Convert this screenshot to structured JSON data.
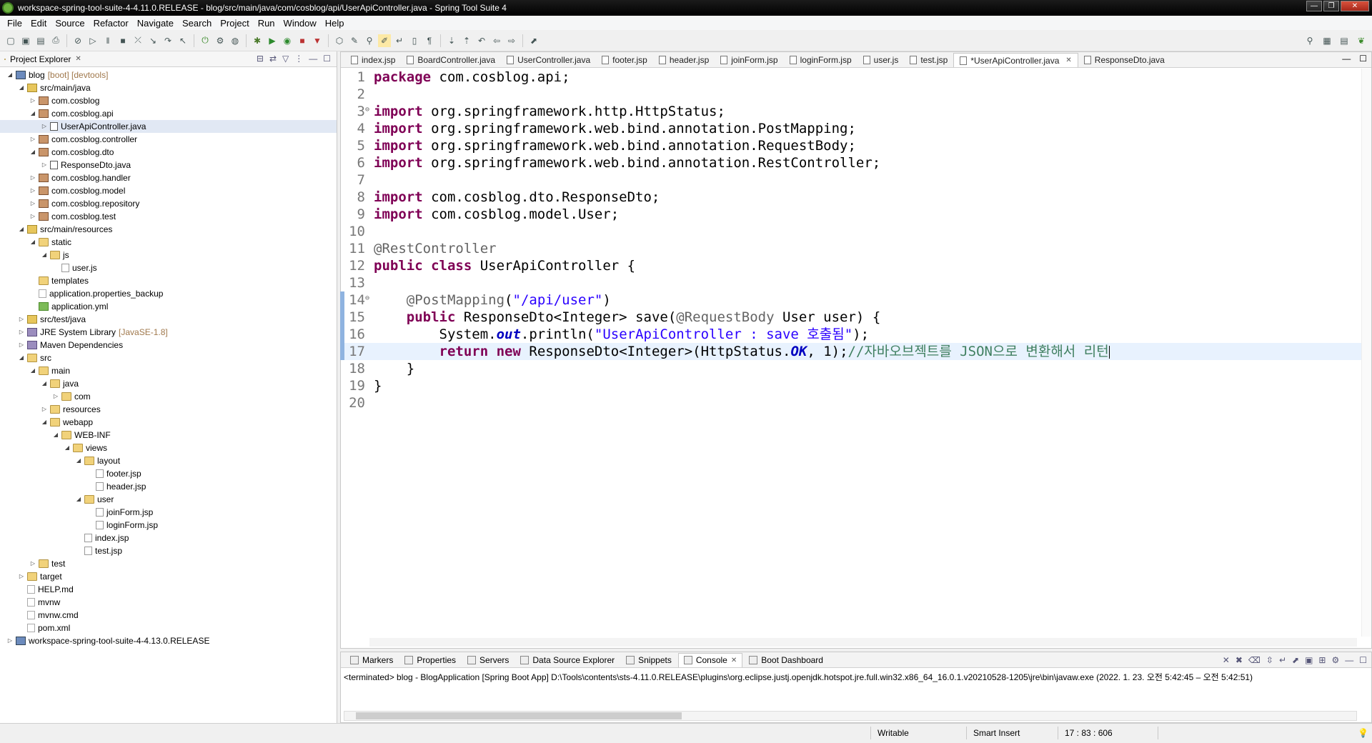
{
  "window": {
    "title": "workspace-spring-tool-suite-4-4.11.0.RELEASE - blog/src/main/java/com/cosblog/api/UserApiController.java - Spring Tool Suite 4",
    "buttons": [
      "—",
      "❐",
      "✕"
    ]
  },
  "menu": [
    "File",
    "Edit",
    "Source",
    "Refactor",
    "Navigate",
    "Search",
    "Project",
    "Run",
    "Window",
    "Help"
  ],
  "explorer": {
    "title": "Project Explorer",
    "tree": [
      {
        "label": "blog",
        "decor": "[boot] [devtools]",
        "depth": 0,
        "expanded": true,
        "icon": "project"
      },
      {
        "label": "src/main/java",
        "depth": 1,
        "expanded": true,
        "icon": "srcfolder"
      },
      {
        "label": "com.cosblog",
        "depth": 2,
        "expanded": false,
        "icon": "pkg"
      },
      {
        "label": "com.cosblog.api",
        "depth": 2,
        "expanded": true,
        "icon": "pkg"
      },
      {
        "label": "UserApiController.java",
        "depth": 3,
        "expanded": false,
        "icon": "java",
        "selected": true
      },
      {
        "label": "com.cosblog.controller",
        "depth": 2,
        "expanded": false,
        "icon": "pkg"
      },
      {
        "label": "com.cosblog.dto",
        "depth": 2,
        "expanded": true,
        "icon": "pkg"
      },
      {
        "label": "ResponseDto.java",
        "depth": 3,
        "expanded": false,
        "icon": "java"
      },
      {
        "label": "com.cosblog.handler",
        "depth": 2,
        "expanded": false,
        "icon": "pkg"
      },
      {
        "label": "com.cosblog.model",
        "depth": 2,
        "expanded": false,
        "icon": "pkg"
      },
      {
        "label": "com.cosblog.repository",
        "depth": 2,
        "expanded": false,
        "icon": "pkg"
      },
      {
        "label": "com.cosblog.test",
        "depth": 2,
        "expanded": false,
        "icon": "pkg"
      },
      {
        "label": "src/main/resources",
        "depth": 1,
        "expanded": true,
        "icon": "srcfolder"
      },
      {
        "label": "static",
        "depth": 2,
        "expanded": true,
        "icon": "folder"
      },
      {
        "label": "js",
        "depth": 3,
        "expanded": true,
        "icon": "folder"
      },
      {
        "label": "user.js",
        "depth": 4,
        "leaf": true,
        "icon": "js"
      },
      {
        "label": "templates",
        "depth": 2,
        "leaf": true,
        "icon": "folder"
      },
      {
        "label": "application.properties_backup",
        "depth": 2,
        "leaf": true,
        "icon": "file"
      },
      {
        "label": "application.yml",
        "depth": 2,
        "leaf": true,
        "icon": "yml"
      },
      {
        "label": "src/test/java",
        "depth": 1,
        "expanded": false,
        "icon": "srcfolder"
      },
      {
        "label": "JRE System Library",
        "decor": "[JavaSE-1.8]",
        "depth": 1,
        "expanded": false,
        "icon": "lib"
      },
      {
        "label": "Maven Dependencies",
        "depth": 1,
        "expanded": false,
        "icon": "lib"
      },
      {
        "label": "src",
        "depth": 1,
        "expanded": true,
        "icon": "folder"
      },
      {
        "label": "main",
        "depth": 2,
        "expanded": true,
        "icon": "folder"
      },
      {
        "label": "java",
        "depth": 3,
        "expanded": true,
        "icon": "folder"
      },
      {
        "label": "com",
        "depth": 4,
        "expanded": false,
        "icon": "folder"
      },
      {
        "label": "resources",
        "depth": 3,
        "expanded": false,
        "icon": "folder"
      },
      {
        "label": "webapp",
        "depth": 3,
        "expanded": true,
        "icon": "folder"
      },
      {
        "label": "WEB-INF",
        "depth": 4,
        "expanded": true,
        "icon": "folder"
      },
      {
        "label": "views",
        "depth": 5,
        "expanded": true,
        "icon": "folder"
      },
      {
        "label": "layout",
        "depth": 6,
        "expanded": true,
        "icon": "folder"
      },
      {
        "label": "footer.jsp",
        "depth": 7,
        "leaf": true,
        "icon": "jsp"
      },
      {
        "label": "header.jsp",
        "depth": 7,
        "leaf": true,
        "icon": "jsp"
      },
      {
        "label": "user",
        "depth": 6,
        "expanded": true,
        "icon": "folder"
      },
      {
        "label": "joinForm.jsp",
        "depth": 7,
        "leaf": true,
        "icon": "jsp"
      },
      {
        "label": "loginForm.jsp",
        "depth": 7,
        "leaf": true,
        "icon": "jsp"
      },
      {
        "label": "index.jsp",
        "depth": 6,
        "leaf": true,
        "icon": "jsp"
      },
      {
        "label": "test.jsp",
        "depth": 6,
        "leaf": true,
        "icon": "jsp"
      },
      {
        "label": "test",
        "depth": 2,
        "expanded": false,
        "icon": "folder"
      },
      {
        "label": "target",
        "depth": 1,
        "expanded": false,
        "icon": "folder"
      },
      {
        "label": "HELP.md",
        "depth": 1,
        "leaf": true,
        "icon": "file"
      },
      {
        "label": "mvnw",
        "depth": 1,
        "leaf": true,
        "icon": "file"
      },
      {
        "label": "mvnw.cmd",
        "depth": 1,
        "leaf": true,
        "icon": "file"
      },
      {
        "label": "pom.xml",
        "depth": 1,
        "leaf": true,
        "icon": "file"
      },
      {
        "label": "workspace-spring-tool-suite-4-4.13.0.RELEASE",
        "depth": 0,
        "expanded": false,
        "icon": "project"
      }
    ]
  },
  "editor": {
    "tabs": [
      {
        "label": "index.jsp"
      },
      {
        "label": "BoardController.java"
      },
      {
        "label": "UserController.java"
      },
      {
        "label": "footer.jsp"
      },
      {
        "label": "header.jsp"
      },
      {
        "label": "joinForm.jsp"
      },
      {
        "label": "loginForm.jsp"
      },
      {
        "label": "user.js"
      },
      {
        "label": "test.jsp"
      },
      {
        "label": "*UserApiController.java",
        "active": true
      },
      {
        "label": "ResponseDto.java"
      }
    ],
    "current_line": 17,
    "lines": [
      [
        [
          "kw",
          "package"
        ],
        [
          "",
          " com.cosblog.api;"
        ]
      ],
      [],
      [
        [
          "kw",
          "import"
        ],
        [
          "",
          " org.springframework.http.HttpStatus;"
        ]
      ],
      [
        [
          "kw",
          "import"
        ],
        [
          "",
          " org.springframework.web.bind.annotation.PostMapping;"
        ]
      ],
      [
        [
          "kw",
          "import"
        ],
        [
          "",
          " org.springframework.web.bind.annotation.RequestBody;"
        ]
      ],
      [
        [
          "kw",
          "import"
        ],
        [
          "",
          " org.springframework.web.bind.annotation.RestController;"
        ]
      ],
      [],
      [
        [
          "kw",
          "import"
        ],
        [
          "",
          " com.cosblog.dto.ResponseDto;"
        ]
      ],
      [
        [
          "kw",
          "import"
        ],
        [
          "",
          " com.cosblog.model.User;"
        ]
      ],
      [],
      [
        [
          "ann",
          "@RestController"
        ]
      ],
      [
        [
          "kw",
          "public"
        ],
        [
          "",
          " "
        ],
        [
          "kw",
          "class"
        ],
        [
          "",
          " UserApiController {"
        ]
      ],
      [],
      [
        [
          "",
          "    "
        ],
        [
          "ann",
          "@PostMapping"
        ],
        [
          "",
          "("
        ],
        [
          "str",
          "\"/api/user\""
        ],
        [
          "",
          ")"
        ]
      ],
      [
        [
          "",
          "    "
        ],
        [
          "kw",
          "public"
        ],
        [
          "",
          " ResponseDto<Integer> save("
        ],
        [
          "ann",
          "@RequestBody"
        ],
        [
          "",
          " User user) {"
        ]
      ],
      [
        [
          "",
          "        System."
        ],
        [
          "fld",
          "out"
        ],
        [
          "",
          ".println("
        ],
        [
          "str",
          "\"UserApiController : save 호출됨\""
        ],
        [
          "",
          ");"
        ]
      ],
      [
        [
          "",
          "        "
        ],
        [
          "kw",
          "return"
        ],
        [
          "",
          " "
        ],
        [
          "kw",
          "new"
        ],
        [
          "",
          " ResponseDto<Integer>(HttpStatus."
        ],
        [
          "fld",
          "OK"
        ],
        [
          "",
          ", 1);"
        ],
        [
          "cmt",
          "//자바오브젝트를 JSON으로 변환해서 리턴"
        ]
      ],
      [
        [
          "",
          "    }"
        ]
      ],
      [
        [
          "",
          "}"
        ]
      ],
      []
    ],
    "fold_lines": [
      3,
      14
    ],
    "changed_lines": [
      14,
      15,
      16,
      17
    ]
  },
  "console": {
    "tabs": [
      {
        "label": "Markers"
      },
      {
        "label": "Properties"
      },
      {
        "label": "Servers"
      },
      {
        "label": "Data Source Explorer"
      },
      {
        "label": "Snippets"
      },
      {
        "label": "Console",
        "active": true
      },
      {
        "label": "Boot Dashboard"
      }
    ],
    "text": "<terminated> blog - BlogApplication [Spring Boot App] D:\\Tools\\contents\\sts-4.11.0.RELEASE\\plugins\\org.eclipse.justj.openjdk.hotspot.jre.full.win32.x86_64_16.0.1.v20210528-1205\\jre\\bin\\javaw.exe  (2022. 1. 23. 오전 5:42:45 – 오전 5:42:51)"
  },
  "status": {
    "mode": "Writable",
    "insert": "Smart Insert",
    "position": "17 : 83 : 606"
  }
}
